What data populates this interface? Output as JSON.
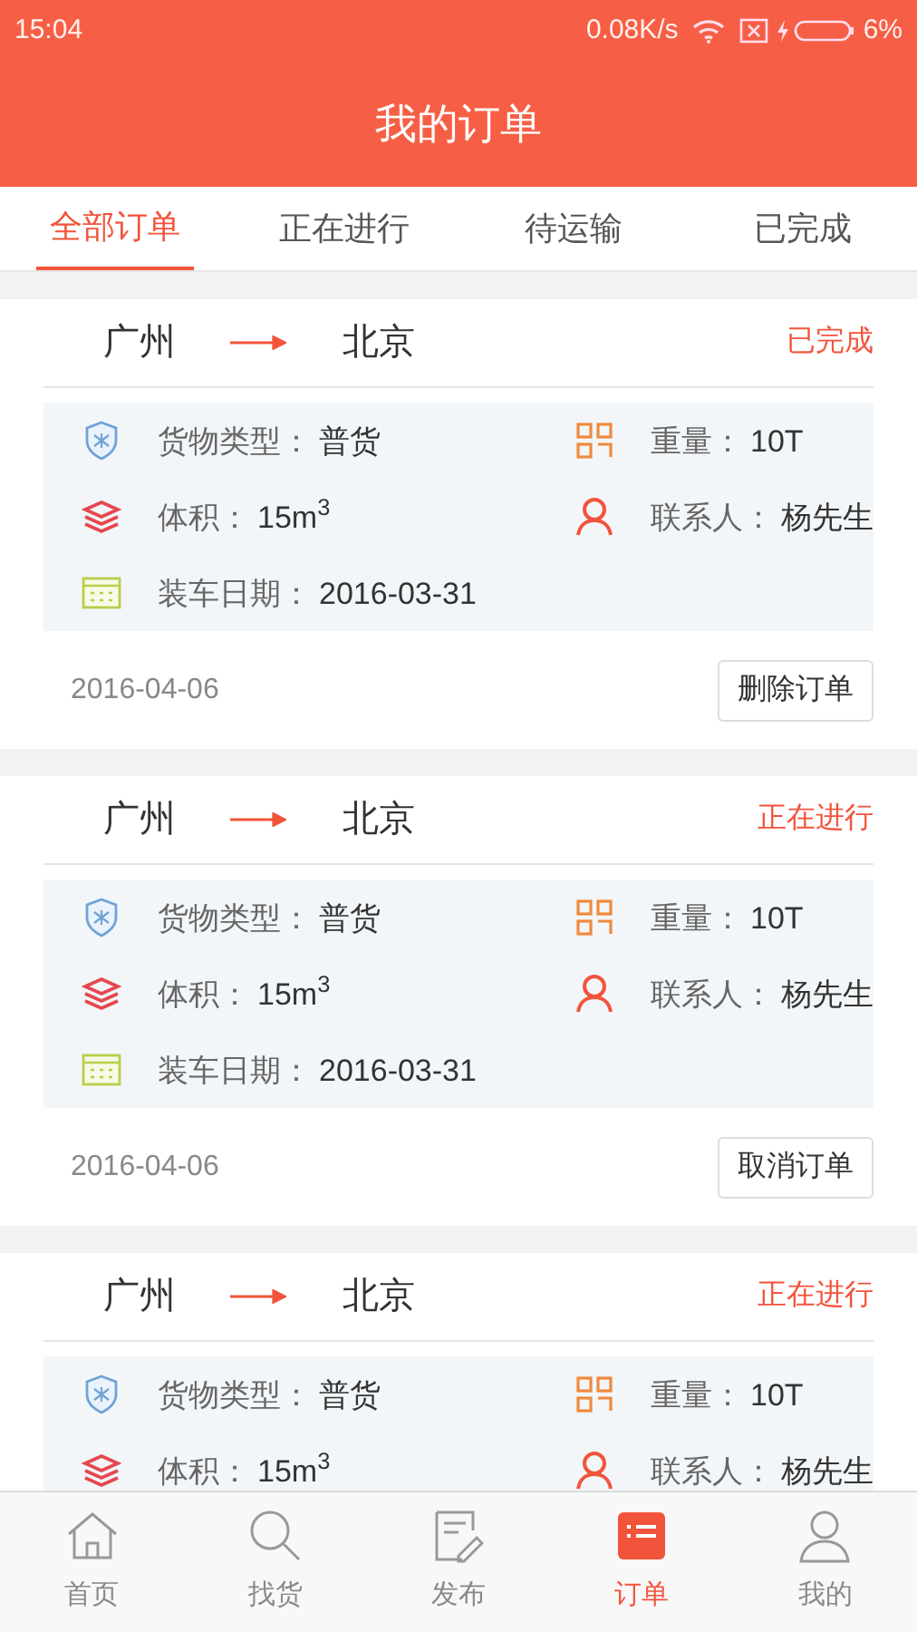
{
  "status_bar": {
    "time": "15:04",
    "speed": "0.08K/s",
    "battery": "6%"
  },
  "header": {
    "title": "我的订单"
  },
  "tabs": [
    {
      "label": "全部订单",
      "selected": true
    },
    {
      "label": "正在进行",
      "selected": false
    },
    {
      "label": "待运输",
      "selected": false
    },
    {
      "label": "已完成",
      "selected": false
    }
  ],
  "orders": [
    {
      "from": "广州",
      "to": "北京",
      "status": "已完成",
      "fields": [
        {
          "kind": "cargo",
          "label": "货物类型：",
          "value": "普货"
        },
        {
          "kind": "weight",
          "label": "重量：",
          "value": "10T"
        },
        {
          "kind": "volume",
          "label": "体积：",
          "value": "15m$^{3}$"
        },
        {
          "kind": "contact",
          "label": "联系人：",
          "value": "杨先生"
        },
        {
          "kind": "date",
          "label": "装车日期：",
          "value": "2016-03-31"
        }
      ],
      "date": "2016-04-06",
      "action": "删除订单"
    },
    {
      "from": "广州",
      "to": "北京",
      "status": "正在进行",
      "fields": [
        {
          "kind": "cargo",
          "label": "货物类型：",
          "value": "普货"
        },
        {
          "kind": "weight",
          "label": "重量：",
          "value": "10T"
        },
        {
          "kind": "volume",
          "label": "体积：",
          "value": "15m$^{3}$"
        },
        {
          "kind": "contact",
          "label": "联系人：",
          "value": "杨先生"
        },
        {
          "kind": "date",
          "label": "装车日期：",
          "value": "2016-03-31"
        }
      ],
      "date": "2016-04-06",
      "action": "取消订单"
    },
    {
      "from": "广州",
      "to": "北京",
      "status": "正在进行",
      "fields": [
        {
          "kind": "cargo",
          "label": "货物类型：",
          "value": "普货"
        },
        {
          "kind": "weight",
          "label": "重量：",
          "value": "10T"
        },
        {
          "kind": "volume",
          "label": "体积：",
          "value": "15m$^{3}$"
        },
        {
          "kind": "contact",
          "label": "联系人：",
          "value": "杨先生"
        }
      ]
    }
  ],
  "nav": [
    {
      "kind": "home",
      "label": "首页",
      "selected": false
    },
    {
      "kind": "search",
      "label": "找货",
      "selected": false
    },
    {
      "kind": "publish",
      "label": "发布",
      "selected": false
    },
    {
      "kind": "orders",
      "label": "订单",
      "selected": true
    },
    {
      "kind": "profile",
      "label": "我的",
      "selected": false
    }
  ]
}
